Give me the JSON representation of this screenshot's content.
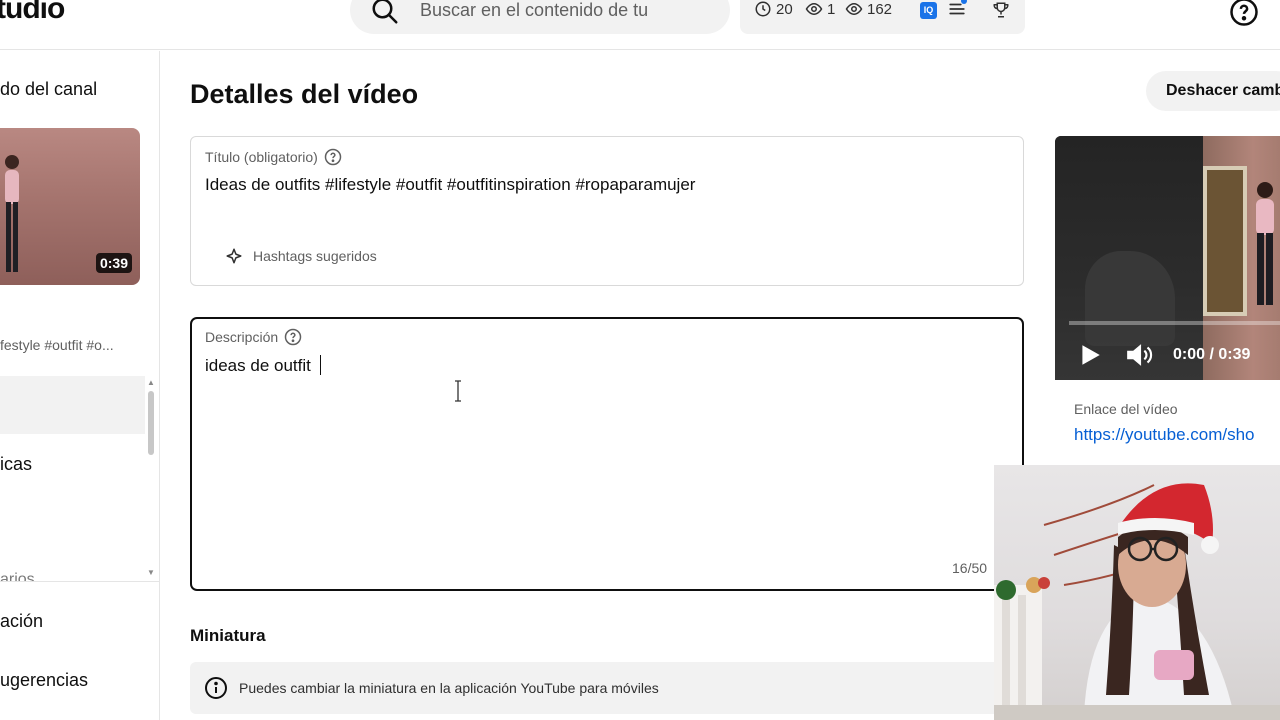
{
  "header": {
    "logo_text": "tudio",
    "search_placeholder": "Buscar en el contenido de tu",
    "stats": {
      "watch_time": "20",
      "viewers": "1",
      "views": "162"
    },
    "iq_label": "IQ"
  },
  "sidebar": {
    "channel_label": "do del canal",
    "thumbnail_duration": "0:39",
    "video_tags": "festyle #outfit #o...",
    "items": [
      {
        "label": "icas"
      },
      {
        "label": "ación"
      },
      {
        "label": "ugerencias"
      }
    ],
    "partial_item": "arios"
  },
  "main": {
    "page_title": "Detalles del vídeo",
    "undo_button": "Deshacer camb",
    "title_field": {
      "label": "Título (obligatorio)",
      "value": "Ideas de outfits #lifestyle #outfit #outfitinspiration #ropaparamujer",
      "hashtags_button": "Hashtags sugeridos"
    },
    "description_field": {
      "label": "Descripción",
      "value": "ideas de outfit ",
      "char_count": "16/50"
    },
    "thumbnail_section": {
      "title": "Miniatura",
      "info": "Puedes cambiar la miniatura en la aplicación YouTube para móviles"
    }
  },
  "preview": {
    "time": "0:00 / 0:39",
    "link_label": "Enlace del vídeo",
    "link_url": "https://youtube.com/sho"
  },
  "colors": {
    "accent_blue": "#065fd4",
    "surface_gray": "#f2f2f2",
    "text_primary": "#0f0f0f",
    "text_secondary": "#606060"
  }
}
